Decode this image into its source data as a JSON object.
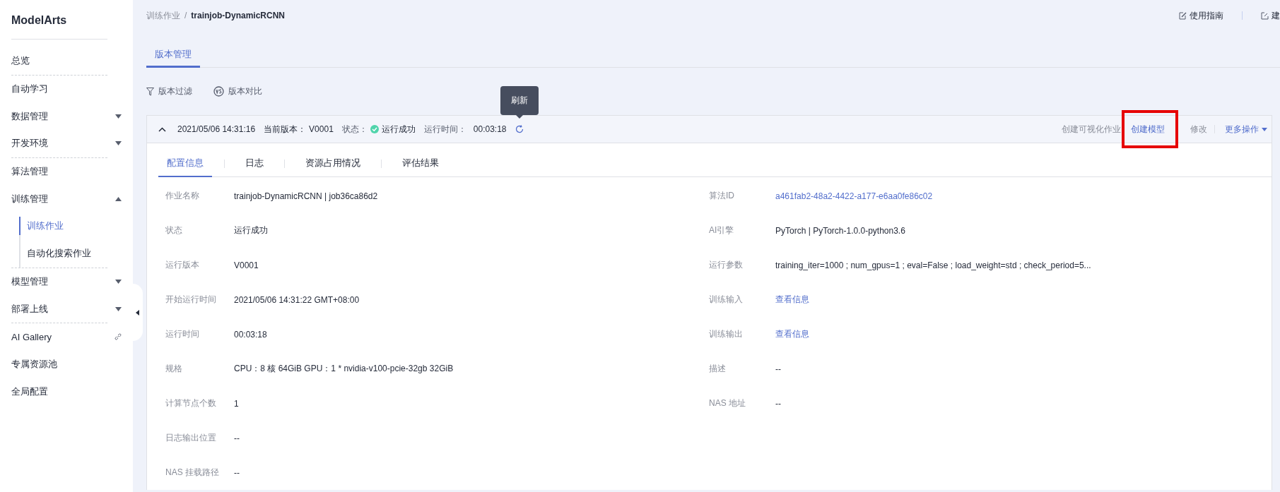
{
  "sidebar": {
    "title": "ModelArts",
    "items": [
      {
        "label": "总览",
        "kind": "item",
        "selected": false,
        "divider_after": true
      },
      {
        "label": "自动学习",
        "kind": "item",
        "selected": false,
        "divider_after": false
      },
      {
        "label": "数据管理",
        "kind": "group",
        "selected": false,
        "expanded": false,
        "divider_after": false
      },
      {
        "label": "开发环境",
        "kind": "group",
        "selected": false,
        "expanded": false,
        "divider_after": true
      },
      {
        "label": "算法管理",
        "kind": "item",
        "selected": false,
        "divider_after": false
      },
      {
        "label": "训练管理",
        "kind": "group",
        "selected": false,
        "expanded": true,
        "divider_after": true,
        "children": [
          {
            "label": "训练作业",
            "selected": true
          },
          {
            "label": "自动化搜索作业",
            "selected": false
          }
        ]
      },
      {
        "label": "模型管理",
        "kind": "group",
        "selected": false,
        "expanded": false,
        "divider_after": false
      },
      {
        "label": "部署上线",
        "kind": "group",
        "selected": false,
        "expanded": false,
        "divider_after": true
      },
      {
        "label": "AI Gallery",
        "kind": "link",
        "selected": false,
        "divider_after": false
      },
      {
        "label": "专属资源池",
        "kind": "item",
        "selected": false,
        "divider_after": false
      },
      {
        "label": "全局配置",
        "kind": "item",
        "selected": false,
        "divider_after": false
      }
    ]
  },
  "breadcrumb": [
    {
      "label": "训练作业",
      "current": false
    },
    {
      "label": "trainjob-DynamicRCNN",
      "current": true
    }
  ],
  "breadcrumb_separator": "/",
  "header_links": [
    {
      "label": "使用指南",
      "kind": "guide"
    },
    {
      "label": "建",
      "kind": "external"
    }
  ],
  "page_tabs": [
    {
      "label": "版本管理",
      "selected": true
    }
  ],
  "toolbar": [
    {
      "label": "版本过滤",
      "kind": "filter"
    },
    {
      "label": "版本对比",
      "kind": "compare"
    }
  ],
  "version": {
    "expanded": true,
    "created": "2021/05/06 14:31:16",
    "version_label": "当前版本：",
    "version": "V0001",
    "status_label": "状态：",
    "status": "运行成功",
    "runtime_label": "运行时间：",
    "runtime": "00:03:18",
    "refresh_tooltip": "刷新",
    "actions": [
      {
        "label": "创建可视化作业",
        "kind": "button",
        "disabled": true,
        "highlighted": false
      },
      {
        "label": "创建模型",
        "kind": "button",
        "disabled": false,
        "highlighted": true
      },
      {
        "label": "修改",
        "kind": "button",
        "disabled": true,
        "highlighted": false
      },
      {
        "label": "更多操作",
        "kind": "menu",
        "disabled": false,
        "highlighted": false
      }
    ],
    "tabs": [
      {
        "label": "配置信息",
        "selected": true
      },
      {
        "label": "日志",
        "selected": false
      },
      {
        "label": "资源占用情况",
        "selected": false
      },
      {
        "label": "评估结果",
        "selected": false
      }
    ],
    "details_left": [
      {
        "label": "作业名称",
        "value": "trainjob-DynamicRCNN | job36ca86d2",
        "link": false
      },
      {
        "label": "状态",
        "value": "运行成功",
        "link": false
      },
      {
        "label": "运行版本",
        "value": "V0001",
        "link": false
      },
      {
        "label": "开始运行时间",
        "value": "2021/05/06 14:31:22 GMT+08:00",
        "link": false
      },
      {
        "label": "运行时间",
        "value": "00:03:18",
        "link": false
      },
      {
        "label": "规格",
        "value": "CPU：8 核 64GiB GPU：1 * nvidia-v100-pcie-32gb 32GiB",
        "link": false
      },
      {
        "label": "计算节点个数",
        "value": "1",
        "link": false
      },
      {
        "label": "日志输出位置",
        "value": "--",
        "link": false
      },
      {
        "label": "NAS 挂载路径",
        "value": "--",
        "link": false
      }
    ],
    "details_right": [
      {
        "label": "算法ID",
        "value": "a461fab2-48a2-4422-a177-e6aa0fe86c02",
        "link": true
      },
      {
        "label": "AI引擎",
        "value": "PyTorch | PyTorch-1.0.0-python3.6",
        "link": false
      },
      {
        "label": "运行参数",
        "value": "training_iter=1000 ; num_gpus=1 ; eval=False ; load_weight=std ; check_period=5...",
        "link": false
      },
      {
        "label": "训练输入",
        "value": "查看信息",
        "link": true
      },
      {
        "label": "训练输出",
        "value": "查看信息",
        "link": true
      },
      {
        "label": "描述",
        "value": "--",
        "link": false
      },
      {
        "label": "NAS 地址",
        "value": "--",
        "link": false
      }
    ]
  }
}
